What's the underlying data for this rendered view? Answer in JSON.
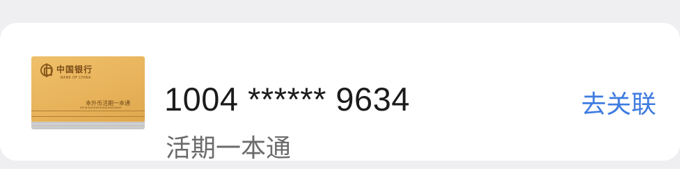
{
  "card": {
    "account_number": "1004 ****** 9634",
    "account_type": "活期一本通",
    "unlink_label": "去关联"
  },
  "passbook": {
    "bank_name_cn": "中国银行",
    "bank_name_en": "BANK OF CHINA",
    "type_label": "本外币活期一本通",
    "serial_text": "ooiiaiiooiooiioiiooiiooiooooi"
  },
  "colors": {
    "background": "#efeff1",
    "card": "#ffffff",
    "primary_text": "#1b1b1b",
    "secondary_text": "#6b6b6b",
    "link": "#3d7be0",
    "passbook_gold": "#e8b35b"
  },
  "icons": {
    "bank_logo": "boc-logo-icon"
  }
}
